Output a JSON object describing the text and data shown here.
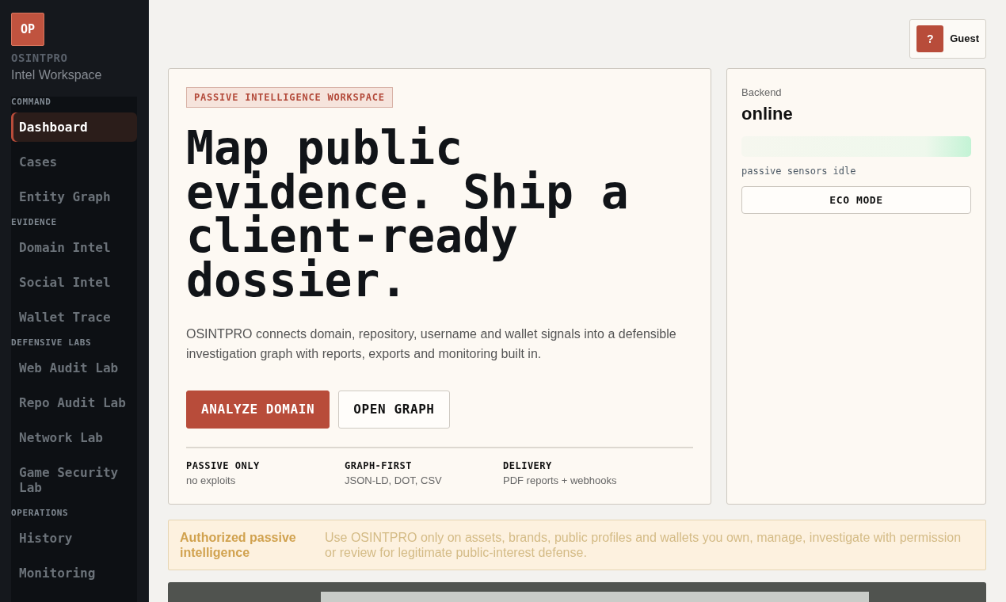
{
  "sidebar": {
    "logo": "OP",
    "brand": "OSINTPRO",
    "subtitle": "Intel Workspace",
    "sections": [
      {
        "title": "COMMAND",
        "items": [
          {
            "label": "Dashboard",
            "selected": true
          },
          {
            "label": "Cases",
            "selected": false
          },
          {
            "label": "Entity Graph",
            "selected": false
          }
        ]
      },
      {
        "title": "EVIDENCE",
        "items": [
          {
            "label": "Domain Intel",
            "selected": false
          },
          {
            "label": "Social Intel",
            "selected": false
          },
          {
            "label": "Wallet Trace",
            "selected": false
          }
        ]
      },
      {
        "title": "DEFENSIVE LABS",
        "items": [
          {
            "label": "Web Audit Lab",
            "selected": false
          },
          {
            "label": "Repo Audit Lab",
            "selected": false
          },
          {
            "label": "Network Lab",
            "selected": false
          },
          {
            "label": "Game Security Lab",
            "selected": false
          }
        ]
      },
      {
        "title": "OPERATIONS",
        "items": [
          {
            "label": "History",
            "selected": false
          },
          {
            "label": "Monitoring",
            "selected": false
          }
        ]
      }
    ]
  },
  "header": {
    "user_button": {
      "avatar": "?",
      "label": "Guest"
    }
  },
  "hero": {
    "badge": "PASSIVE INTELLIGENCE WORKSPACE",
    "headline": "Map public evidence. Ship a client-ready dossier.",
    "description": "OSINTPRO connects domain, repository, username and wallet signals into a defensible investigation graph with reports, exports and monitoring built in.",
    "buttons": [
      {
        "label": "ANALYZE DOMAIN",
        "kind": "primary"
      },
      {
        "label": "OPEN GRAPH",
        "kind": "outline"
      }
    ],
    "features": [
      {
        "title": "PASSIVE ONLY",
        "text": "no exploits"
      },
      {
        "title": "GRAPH-FIRST",
        "text": "JSON-LD, DOT, CSV"
      },
      {
        "title": "DELIVERY",
        "text": "PDF reports + webhooks"
      }
    ]
  },
  "status": {
    "label": "Backend",
    "value": "online",
    "note": "passive sensors idle",
    "button": "ECO MODE"
  },
  "notice": {
    "title": "Authorized passive intelligence",
    "text": "Use OSINTPRO only on assets, brands, public profiles and wallets you own, manage, investigate with permission or review for legitimate public-interest defense."
  }
}
